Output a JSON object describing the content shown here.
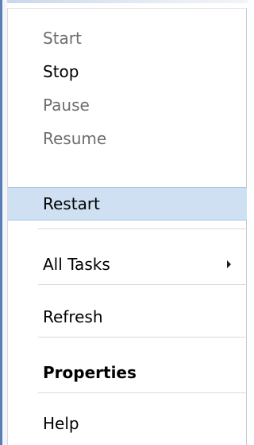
{
  "menu": {
    "items": [
      {
        "label": "Start",
        "state": "disabled"
      },
      {
        "label": "Stop",
        "state": "enabled"
      },
      {
        "label": "Pause",
        "state": "disabled"
      },
      {
        "label": "Resume",
        "state": "disabled"
      },
      {
        "label": "Restart",
        "state": "selected"
      },
      {
        "label": "All Tasks",
        "state": "enabled",
        "submenu_icon": "chevron-right-icon"
      },
      {
        "label": "Refresh",
        "state": "enabled"
      },
      {
        "label": "Properties",
        "state": "default-bold"
      },
      {
        "label": "Help",
        "state": "enabled"
      }
    ]
  },
  "colors": {
    "highlight": "#cfe0f3",
    "highlight_border": "#a9c6e6",
    "disabled_text": "#6d6d6d",
    "window_edge": "#5b7fb3"
  }
}
